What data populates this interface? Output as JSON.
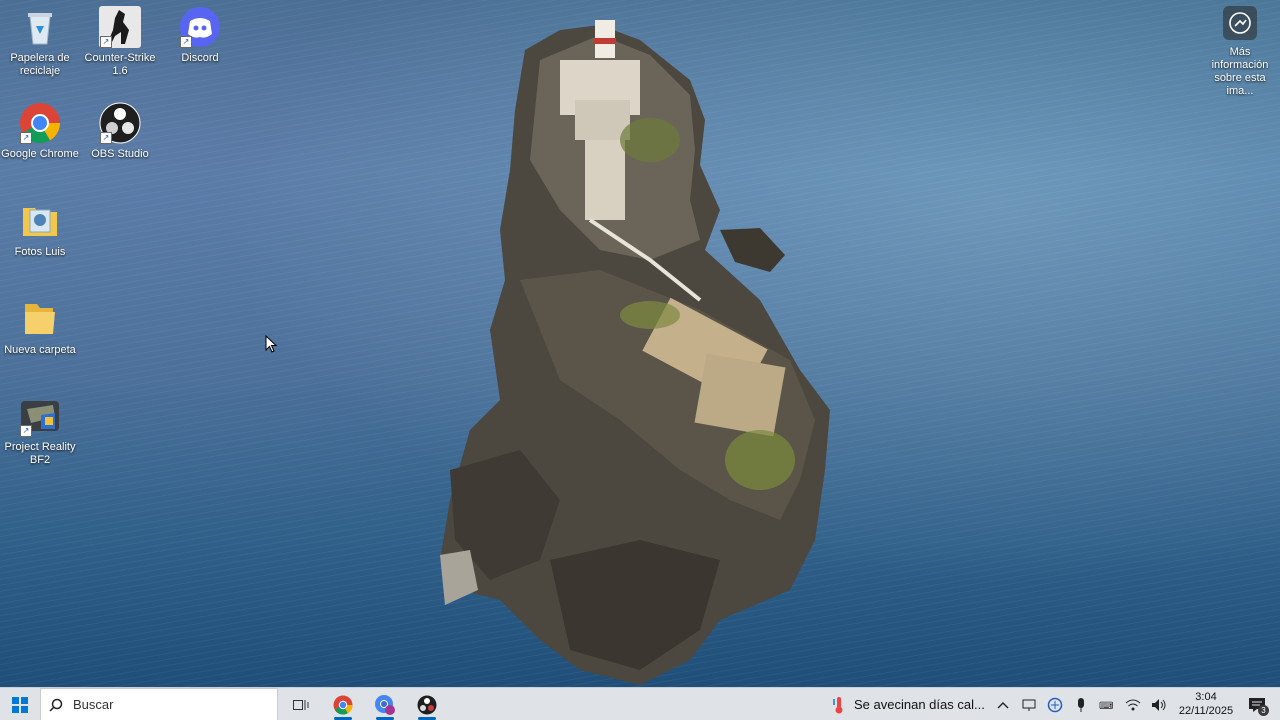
{
  "desktop": {
    "icons": [
      {
        "label": "Papelera de reciclaje",
        "icon": "recycle-bin-icon",
        "shortcut": false
      },
      {
        "label": "Counter-Strike 1.6",
        "icon": "counter-strike-icon",
        "shortcut": true
      },
      {
        "label": "Discord",
        "icon": "discord-icon",
        "shortcut": true
      },
      {
        "label": "Google Chrome",
        "icon": "chrome-icon",
        "shortcut": true
      },
      {
        "label": "OBS Studio",
        "icon": "obs-icon",
        "shortcut": true
      },
      {
        "label": "Fotos Luis",
        "icon": "photos-folder-icon",
        "shortcut": false
      },
      {
        "label": "Nueva carpeta",
        "icon": "folder-icon",
        "shortcut": false
      },
      {
        "label": "Project Reality BF2",
        "icon": "project-reality-icon",
        "shortcut": true
      }
    ],
    "spotlight": {
      "label": "Más información sobre esta ima...",
      "icon": "camera-info-icon"
    }
  },
  "taskbar": {
    "start_icon": "windows-start-icon",
    "search_placeholder": "Buscar",
    "task_view_icon": "task-view-icon",
    "apps": [
      {
        "name": "Google Chrome",
        "icon": "chrome-icon",
        "active": true
      },
      {
        "name": "Chrome profile",
        "icon": "chrome-profile-icon",
        "active": true
      },
      {
        "name": "OBS Studio",
        "icon": "obs-icon",
        "active": true
      }
    ],
    "weather_text": "Se avecinan días cal...",
    "weather_icon": "thermometer-icon",
    "tray": [
      "chevron-up-icon",
      "display-icon",
      "network-shield-icon",
      "microphone-icon",
      "keyboard-icon",
      "wifi-icon",
      "speaker-icon"
    ],
    "time": "3:04",
    "date": "22/11/2025",
    "notification_count": "3"
  },
  "colors": {
    "taskbar_bg": "#dfe3e8",
    "accent": "#0067c0"
  }
}
